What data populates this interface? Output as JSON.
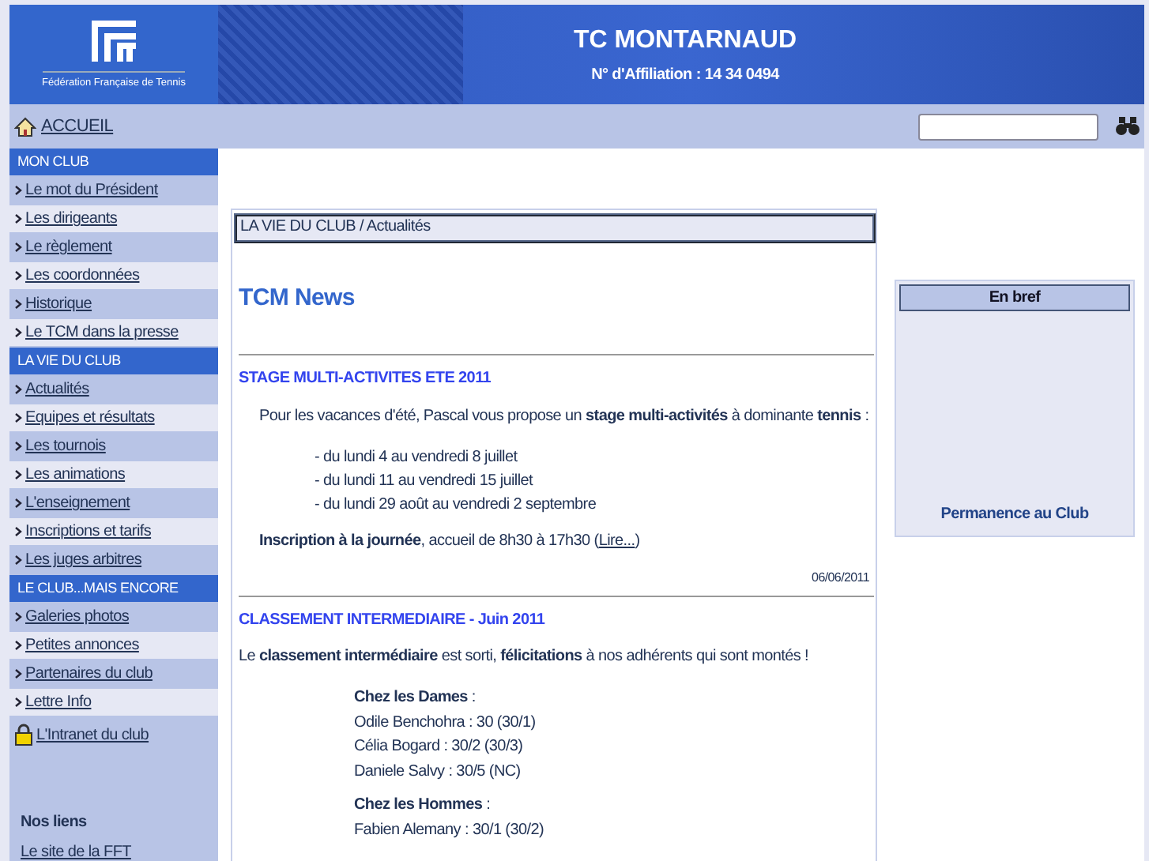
{
  "header": {
    "logo_text": "Fédération Française de Tennis",
    "title": "TC MONTARNAUD",
    "affiliation": "N° d'Affiliation : 14 34 0494"
  },
  "nav": {
    "home": "ACCUEIL"
  },
  "sidebar": {
    "sections": [
      {
        "title": "MON CLUB",
        "items": [
          {
            "label": "Le mot du Président",
            "kind": "arrow"
          },
          {
            "label": "Les dirigeants",
            "kind": "arrow"
          },
          {
            "label": "Le règlement",
            "kind": "arrow"
          },
          {
            "label": "Les coordonnées",
            "kind": "arrow"
          },
          {
            "label": "Historique",
            "kind": "arrow"
          },
          {
            "label": "Le TCM dans la presse",
            "kind": "arrow"
          }
        ]
      },
      {
        "title": "LA VIE DU CLUB",
        "items": [
          {
            "label": "Actualités",
            "kind": "arrow"
          },
          {
            "label": "Equipes et résultats",
            "kind": "arrow"
          },
          {
            "label": "Les tournois",
            "kind": "arrow"
          },
          {
            "label": "Les animations",
            "kind": "arrow"
          },
          {
            "label": "L'enseignement",
            "kind": "arrow"
          },
          {
            "label": "Inscriptions et tarifs",
            "kind": "arrow"
          },
          {
            "label": "Les juges arbitres",
            "kind": "arrow"
          }
        ]
      },
      {
        "title": "LE CLUB...MAIS ENCORE",
        "items": [
          {
            "label": "Galeries photos",
            "kind": "arrow"
          },
          {
            "label": "Petites annonces",
            "kind": "arrow"
          },
          {
            "label": "Partenaires du club",
            "kind": "arrow"
          },
          {
            "label": "Lettre Info",
            "kind": "arrow"
          },
          {
            "label": "L'Intranet du club",
            "kind": "lock"
          }
        ]
      }
    ],
    "links": {
      "title": "Nos liens",
      "items": [
        "Le site de la FFT"
      ]
    }
  },
  "content": {
    "breadcrumb": "LA VIE DU CLUB / Actualités",
    "heading": "TCM News",
    "article_1": {
      "title": "STAGE MULTI-ACTIVITES ETE 2011",
      "intro": "Pour les vacances d'été, Pascal vous propose un **stage multi-activités** à dominante **tennis** :",
      "dates": [
        "- du lundi 4 au vendredi 8 juillet",
        "- du lundi 11 au vendredi 15 juillet",
        "- du lundi 29 août au vendredi 2 septembre"
      ],
      "footer": "**Inscription à la journée**, accueil de 8h30 à 17h30 (",
      "link": "Lire...",
      "footer_end": ")",
      "date": "06/06/2011"
    },
    "article_2": {
      "title": "CLASSEMENT INTERMEDIAIRE - Juin 2011",
      "intro": "Le **classement intermédiaire** est sorti, **félicitations** à nos adhérents qui sont montés !",
      "groups": [
        {
          "heading": "**Chez les Dames** :",
          "lines": [
            "Odile Benchohra : 30 (30/1)",
            "Célia Bogard : 30/2 (30/3)",
            "Daniele Salvy : 30/5 (NC)"
          ]
        },
        {
          "heading": "**Chez les Hommes** :",
          "lines": [
            "Fabien Alemany : 30/1 (30/2)"
          ]
        }
      ]
    }
  },
  "aside": {
    "title": "En bref",
    "item": "Permanence au Club"
  }
}
